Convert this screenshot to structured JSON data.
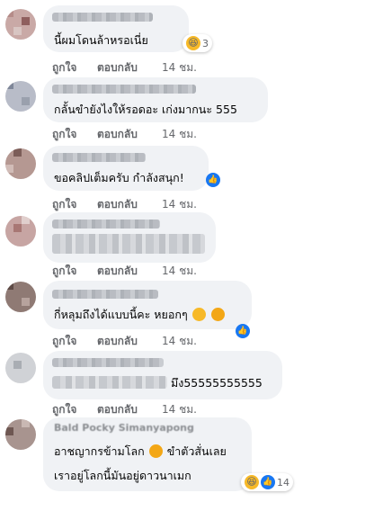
{
  "actions": {
    "like": "ถูกใจ",
    "reply": "ตอบกลับ"
  },
  "comments": [
    {
      "text": "นี้ผมโดนล้าหรอเนี่ย",
      "time": "14 ชม.",
      "reaction_count": "3"
    },
    {
      "text": "กลั้นขำยังไงให้รอดอะ เก่งมากนะ 555",
      "time": "14 ชม."
    },
    {
      "text": "ขอคลิปเต็มครับ กำลังสนุก!",
      "time": "14 ชม."
    },
    {
      "text": "",
      "time": "14 ชม."
    },
    {
      "text": "กี่หลุมถึงได้แบบนี้คะ หยอกๆ",
      "time": "14 ชม."
    },
    {
      "text": "มึง55555555555",
      "time": "14 ชม."
    },
    {
      "name": "Bald Pocky Simanyapong",
      "text_line1_a": "อาชญากรข้ามโลก",
      "text_line1_b": "ขำตัวสั่นเลย",
      "text_line2": "เราอยู่โลกนี้มันอยู่ดาวนาเมก",
      "reaction_count": "14"
    }
  ],
  "icons": [
    "haha-reaction",
    "like-reaction",
    "rofl-emoji"
  ]
}
